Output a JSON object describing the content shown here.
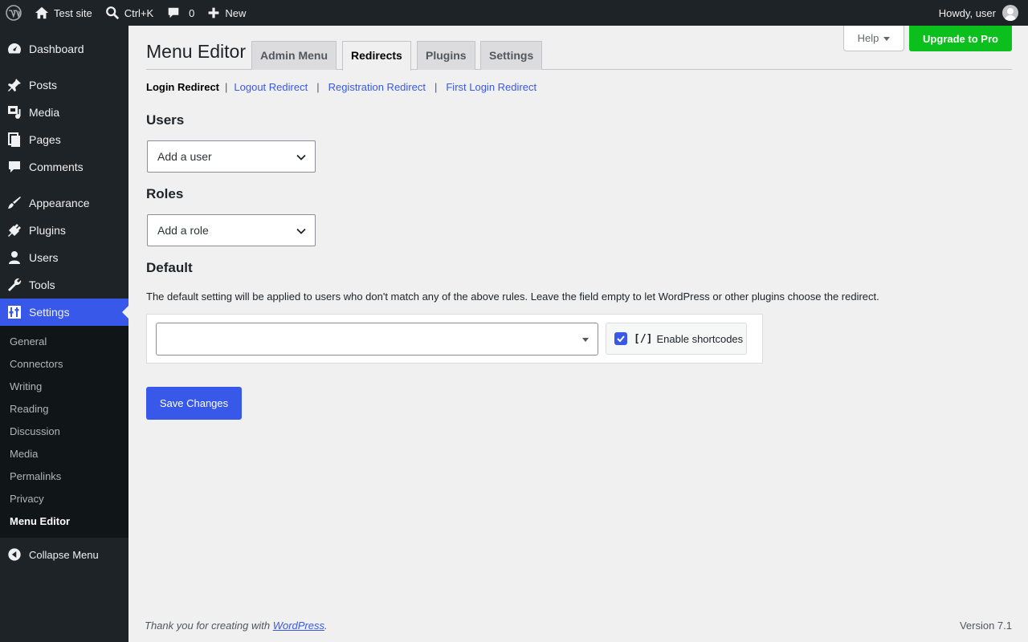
{
  "adminbar": {
    "wp_logo_icon": "wordpress-logo-icon",
    "site_name": "Test site",
    "search_shortcut": "Ctrl+K",
    "comments_count": "0",
    "new_label": "New",
    "howdy": "Howdy, user"
  },
  "sidebar": {
    "items": [
      {
        "label": "Dashboard",
        "icon": "dashboard-icon"
      },
      {
        "label": "Posts",
        "icon": "pin-icon"
      },
      {
        "label": "Media",
        "icon": "media-icon"
      },
      {
        "label": "Pages",
        "icon": "pages-icon"
      },
      {
        "label": "Comments",
        "icon": "comment-icon"
      },
      {
        "label": "Appearance",
        "icon": "brush-icon"
      },
      {
        "label": "Plugins",
        "icon": "plug-icon"
      },
      {
        "label": "Users",
        "icon": "user-icon"
      },
      {
        "label": "Tools",
        "icon": "wrench-icon"
      },
      {
        "label": "Settings",
        "icon": "settings-icon"
      }
    ],
    "submenu": [
      "General",
      "Connectors",
      "Writing",
      "Reading",
      "Discussion",
      "Media",
      "Permalinks",
      "Privacy",
      "Menu Editor"
    ],
    "collapse_label": "Collapse Menu"
  },
  "header": {
    "help_label": "Help",
    "upgrade_label": "Upgrade to Pro",
    "title": "Menu Editor",
    "tabs": [
      {
        "label": "Admin Menu"
      },
      {
        "label": "Redirects"
      },
      {
        "label": "Plugins"
      },
      {
        "label": "Settings"
      }
    ]
  },
  "subnav": {
    "current": "Login Redirect",
    "links": [
      "Logout Redirect",
      "Registration Redirect",
      "First Login Redirect"
    ],
    "separator": "|"
  },
  "form": {
    "users_heading": "Users",
    "users_select": "Add a user",
    "roles_heading": "Roles",
    "roles_select": "Add a role",
    "default_heading": "Default",
    "default_desc": "The default setting will be applied to users who don't match any of the above rules. Leave the field empty to let WordPress or other plugins choose the redirect.",
    "default_url_value": "",
    "shortcodes_checked": true,
    "shortcodes_icon": "[/]",
    "shortcodes_label": "Enable shortcodes",
    "save_label": "Save Changes"
  },
  "footer": {
    "thanks_prefix": "Thank you for creating with ",
    "thanks_link": "WordPress",
    "thanks_suffix": ".",
    "version": "Version 7.1"
  },
  "colors": {
    "accent": "#3858e9",
    "adminbar_bg": "#1d2327",
    "upgrade_green": "#0bbf1d",
    "page_bg": "#f0f0f1"
  }
}
